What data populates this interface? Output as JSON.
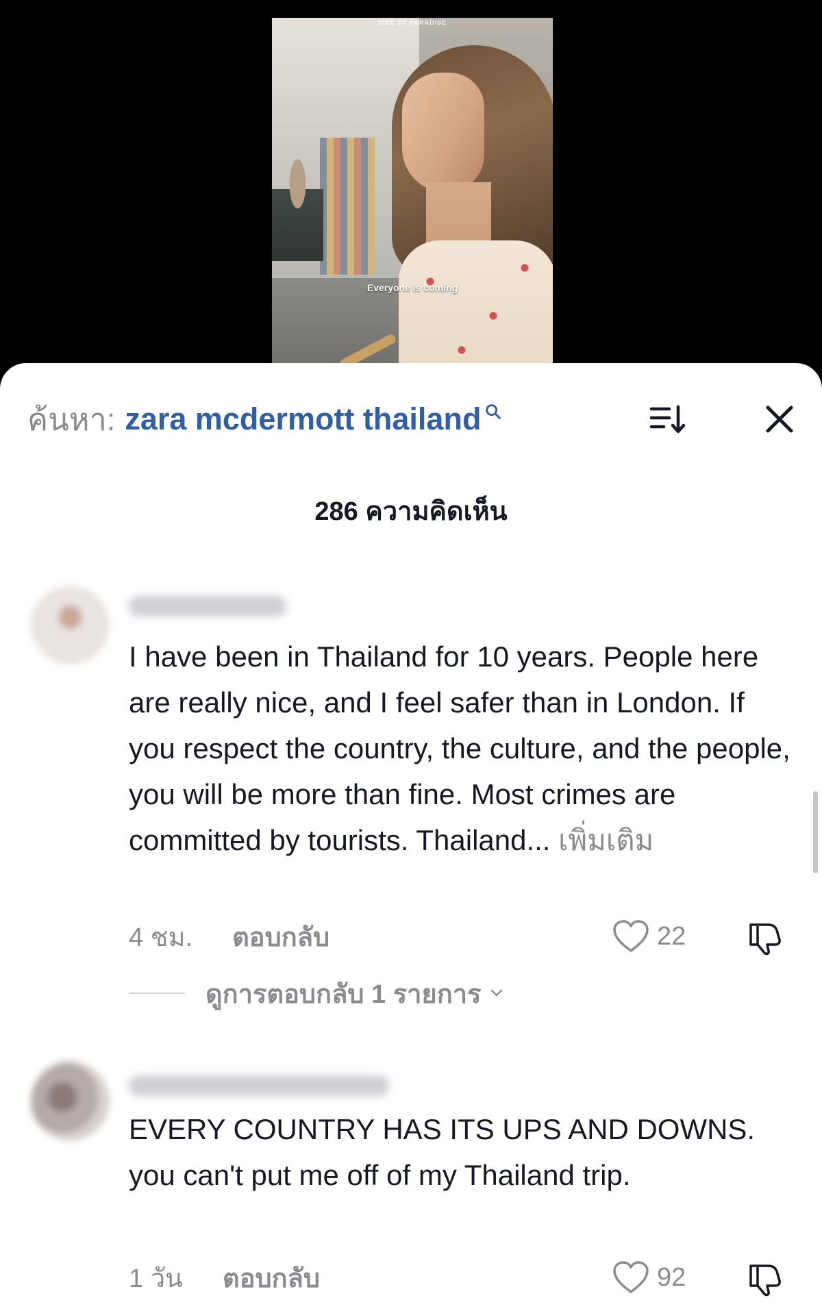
{
  "video": {
    "watermark": "SIDE OF PARADISE",
    "caption": "Everyone is coming"
  },
  "search": {
    "label": "ค้นหา:",
    "query": "zara mcdermott thailand"
  },
  "comments_count": "286 ความคิดเห็น",
  "comments": [
    {
      "text": "I have been in Thailand for 10 years. People here are really nice, and I feel safer than in London. If you respect the country, the culture, and the people, you will be more than fine. Most crimes are committed by tourists. Thailand...",
      "more": "เพิ่มเติม",
      "time": "4 ชม.",
      "reply": "ตอบกลับ",
      "likes": "22",
      "view_replies": "ดูการตอบกลับ 1 รายการ"
    },
    {
      "text": "EVERY COUNTRY HAS ITS UPS AND DOWNS. you can't put me off of my Thailand trip.",
      "time": "1 วัน",
      "reply": "ตอบกลับ",
      "likes": "92"
    }
  ],
  "icons": {
    "search": "search-icon",
    "sort": "sort-icon",
    "close": "close-icon",
    "like": "heart-icon",
    "dislike": "thumbs-down-icon",
    "chevron": "chevron-down-icon"
  },
  "colors": {
    "query": "#2f5faa",
    "text": "#161823",
    "muted": "#8a8b91",
    "sheet": "#ffffff",
    "backdrop": "#000000"
  }
}
